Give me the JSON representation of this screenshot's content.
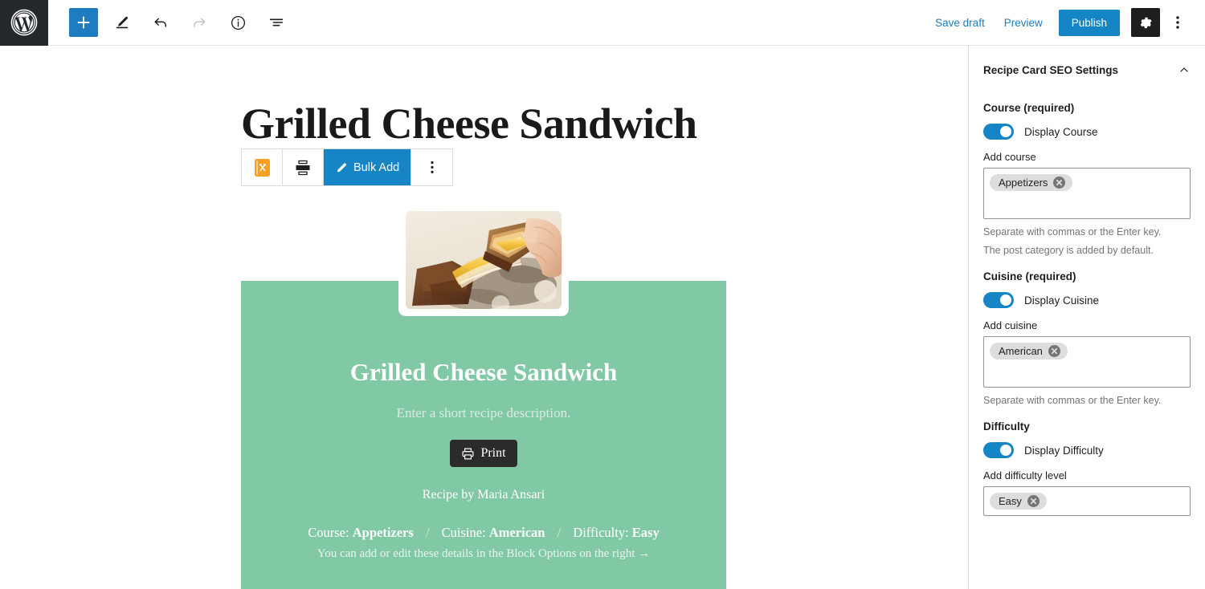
{
  "app": {
    "logo_icon": "wordpress-logo-icon"
  },
  "toolbar": {
    "left_items": [
      {
        "name": "add-block-button",
        "icon": "plus-icon",
        "label": ""
      },
      {
        "name": "edit-tool-button",
        "icon": "pencil-icon",
        "label": ""
      },
      {
        "name": "undo-button",
        "icon": "undo-arrow-icon",
        "label": ""
      },
      {
        "name": "redo-button",
        "icon": "redo-arrow-icon",
        "label": ""
      },
      {
        "name": "details-button",
        "icon": "info-circle-icon",
        "label": ""
      },
      {
        "name": "list-view-button",
        "icon": "list-view-icon",
        "label": ""
      }
    ],
    "save_draft_label": "Save draft",
    "preview_label": "Preview",
    "publish_label": "Publish",
    "settings_icon": "gear-icon",
    "options_icon": "kebab-menu-icon",
    "accent_blue": "#1685c5"
  },
  "editor": {
    "post_title": "Grilled Cheese Sandwich",
    "block_toolbar": {
      "recipe_icon": "recipe-card-icon",
      "align_icon": "align-center-icon",
      "bulk_add_label": "Bulk Add",
      "bulk_add_icon": "pencil-icon",
      "more_icon": "kebab-menu-icon"
    },
    "recipe_card": {
      "image_alt": "grilled-cheese-sandwich-photo",
      "title": "Grilled Cheese Sandwich",
      "description_placeholder": "Enter a short recipe description.",
      "print_label": "Print",
      "print_icon": "printer-icon",
      "author_line": "Recipe by Maria Ansari",
      "meta": [
        {
          "label": "Course:",
          "value": "Appetizers"
        },
        {
          "label": "Cuisine:",
          "value": "American"
        },
        {
          "label": "Difficulty:",
          "value": "Easy"
        }
      ],
      "separator": "/",
      "hint": "You can add or edit these details in the Block Options on the right →",
      "background_color": "#81c9a5"
    }
  },
  "sidebar": {
    "panel_title": "Recipe Card SEO Settings",
    "collapse_icon": "chevron-up-icon",
    "sections": [
      {
        "heading": "Course (required)",
        "toggle_label": "Display Course",
        "toggle_on": true,
        "input_label": "Add course",
        "tokens": [
          "Appetizers"
        ],
        "help": [
          "Separate with commas or the Enter key.",
          "The post category is added by default."
        ]
      },
      {
        "heading": "Cuisine (required)",
        "toggle_label": "Display Cuisine",
        "toggle_on": true,
        "input_label": "Add cuisine",
        "tokens": [
          "American"
        ],
        "help": [
          "Separate with commas or the Enter key."
        ]
      },
      {
        "heading": "Difficulty",
        "toggle_label": "Display Difficulty",
        "toggle_on": true,
        "input_label": "Add difficulty level",
        "tokens": [
          "Easy"
        ],
        "help": []
      }
    ]
  }
}
